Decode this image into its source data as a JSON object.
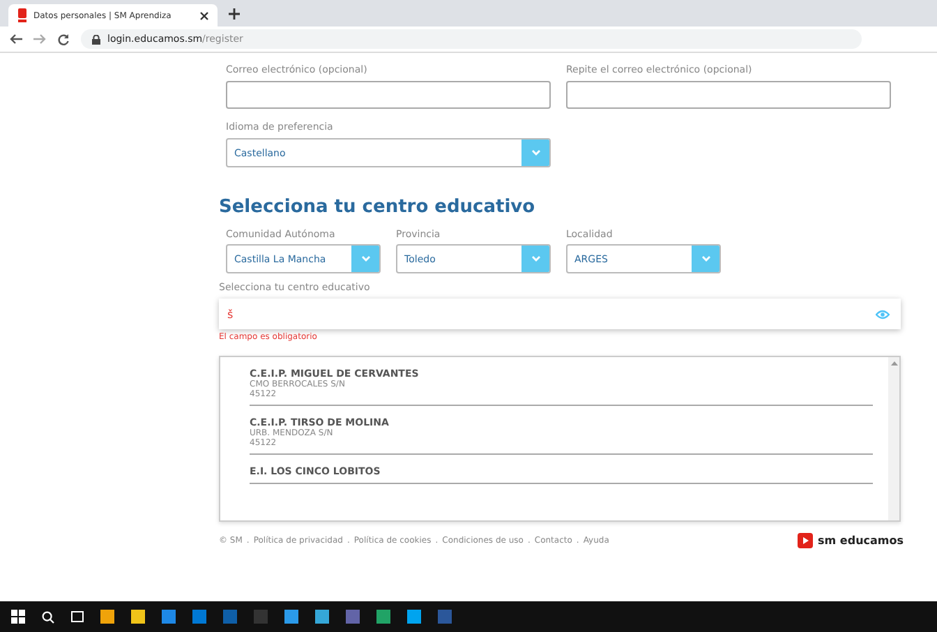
{
  "browser": {
    "tab_title": "Datos personales | SM Aprendiza",
    "url_host": "login.educamos.sm",
    "url_path": "/register"
  },
  "email_fields": [
    {
      "label": "Correo electrónico (opcional)"
    },
    {
      "label": "Repite el correo electrónico (opcional)"
    }
  ],
  "language": {
    "label": "Idioma de preferencia",
    "value": "Castellano"
  },
  "heading": "Selecciona tu centro educativo",
  "location_selects": [
    {
      "label": "Comunidad Autónoma",
      "value": "Castilla La Mancha"
    },
    {
      "label": "Provincia",
      "value": "Toledo"
    },
    {
      "label": "Localidad",
      "value": "ARGES"
    }
  ],
  "school_field": {
    "label": "Selecciona tu centro educativo",
    "value": "š",
    "error": "El campo es obligatorio"
  },
  "schools": [
    {
      "name": "C.E.I.P. MIGUEL DE CERVANTES",
      "address": "CMO BERROCALES S/N",
      "postcode": "45122"
    },
    {
      "name": "C.E.I.P. TIRSO DE MOLINA",
      "address": "URB. MENDOZA S/N",
      "postcode": "45122"
    },
    {
      "name": "E.I. LOS CINCO LOBITOS"
    }
  ],
  "footer": {
    "links": [
      "© SM",
      "Política de privacidad",
      "Política de cookies",
      "Condiciones de uso",
      "Contacto",
      "Ayuda"
    ],
    "separator": ".",
    "brand": "sm educamos"
  }
}
